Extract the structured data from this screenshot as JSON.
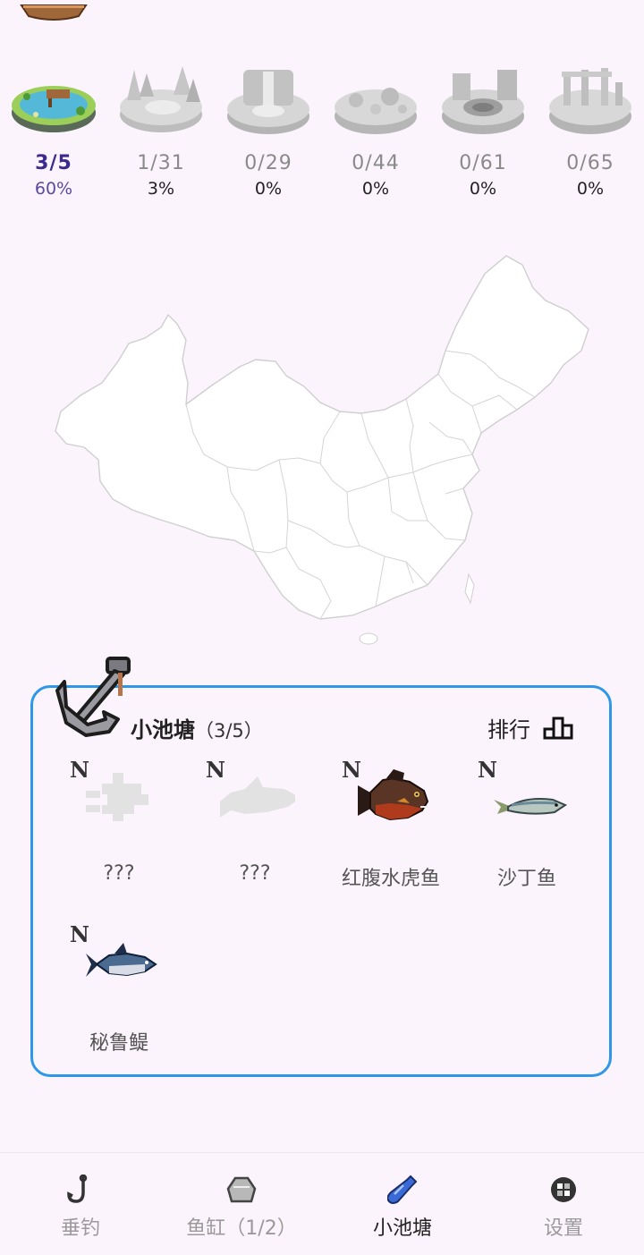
{
  "locations": [
    {
      "name": "pond",
      "count": "3/5",
      "percent": "60%",
      "active": true
    },
    {
      "name": "forest",
      "count": "1/31",
      "percent": "3%",
      "active": false
    },
    {
      "name": "waterfall",
      "count": "0/29",
      "percent": "0%",
      "active": false
    },
    {
      "name": "reef",
      "count": "0/44",
      "percent": "0%",
      "active": false
    },
    {
      "name": "abyss",
      "count": "0/61",
      "percent": "0%",
      "active": false
    },
    {
      "name": "ruins",
      "count": "0/65",
      "percent": "0%",
      "active": false
    }
  ],
  "panel": {
    "title": "小池塘",
    "count": "（3/5）",
    "rank_label": "排行"
  },
  "fish": [
    {
      "badge": "N",
      "name": "???",
      "icon": "unknown-fish-icon",
      "known": false
    },
    {
      "badge": "N",
      "name": "???",
      "icon": "unknown-shark-icon",
      "known": false
    },
    {
      "badge": "N",
      "name": "红腹水虎鱼",
      "icon": "piranha-icon",
      "known": true
    },
    {
      "badge": "N",
      "name": "沙丁鱼",
      "icon": "sardine-icon",
      "known": true
    },
    {
      "badge": "N",
      "name": "秘鲁鳀",
      "icon": "anchovy-icon",
      "known": true
    }
  ],
  "nav": {
    "fishing": "垂钓",
    "tank": "鱼缸（1/2）",
    "pond": "小池塘",
    "settings": "设置"
  },
  "colors": {
    "background": "#fcf4fc",
    "panel_border": "#2f97e8",
    "active_count": "#3d2a8e"
  }
}
